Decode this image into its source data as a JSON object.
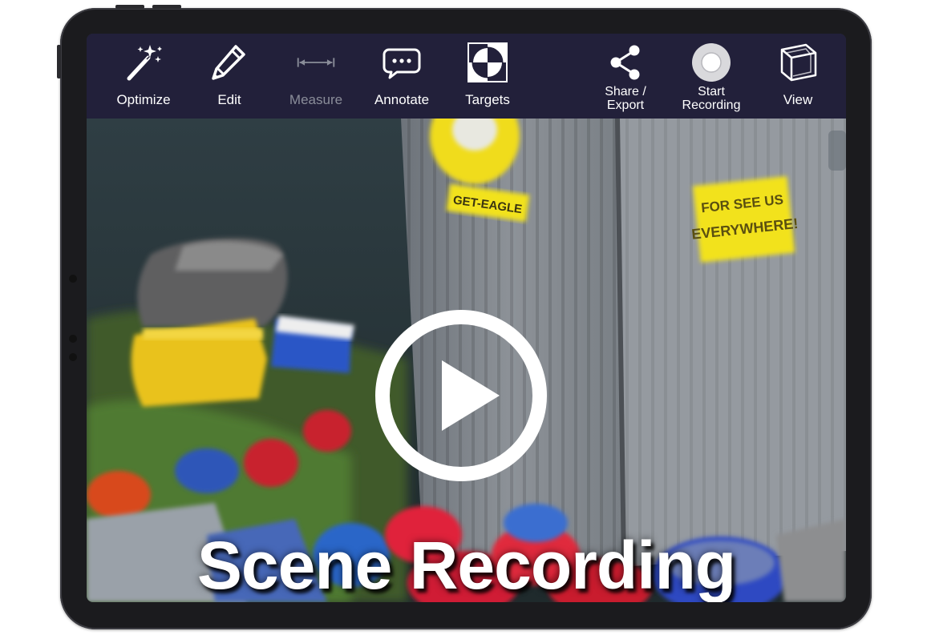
{
  "toolbar": {
    "items": [
      {
        "id": "optimize",
        "label": "Optimize",
        "icon": "magic-wand-icon",
        "enabled": true
      },
      {
        "id": "edit",
        "label": "Edit",
        "icon": "pencil-icon",
        "enabled": true
      },
      {
        "id": "measure",
        "label": "Measure",
        "icon": "measure-icon",
        "enabled": false
      },
      {
        "id": "annotate",
        "label": "Annotate",
        "icon": "speech-bubble-icon",
        "enabled": true
      },
      {
        "id": "targets",
        "label": "Targets",
        "icon": "target-checker-icon",
        "enabled": true
      },
      {
        "id": "share",
        "label_line1": "Share /",
        "label_line2": "Export",
        "icon": "share-icon",
        "enabled": true
      },
      {
        "id": "record",
        "label_line1": "Start",
        "label_line2": "Recording",
        "icon": "record-icon",
        "enabled": true
      },
      {
        "id": "view",
        "label": "View",
        "icon": "cube-icon",
        "enabled": true
      }
    ]
  },
  "scene": {
    "sign_top": "GET-EAGLE",
    "sign_right_line1": "FOR SEE US",
    "sign_right_line2": "EVERYWHERE!",
    "caption": "Scene Recording"
  },
  "colors": {
    "toolbar_bg": "#22203a",
    "disabled_label": "#8a8d99",
    "sign_yellow": "#f2e21a"
  }
}
